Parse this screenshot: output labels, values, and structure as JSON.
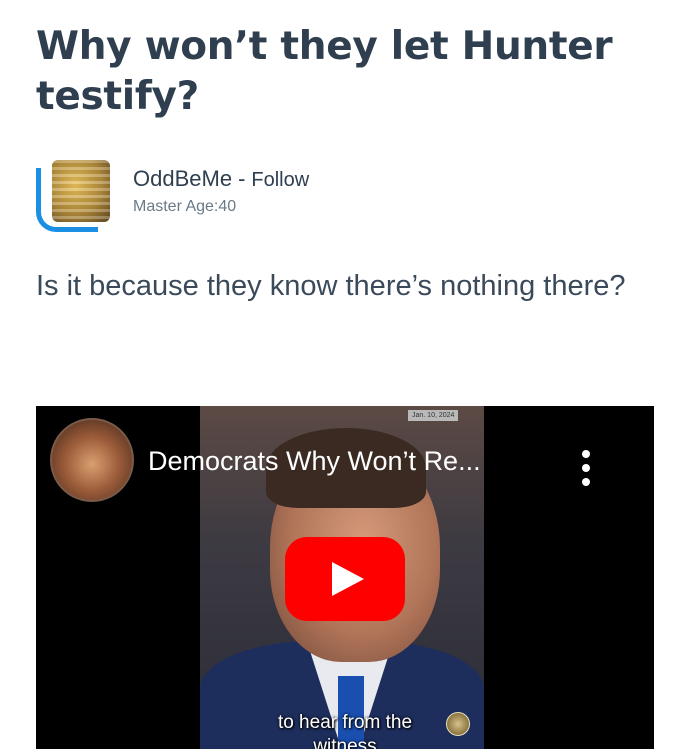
{
  "article": {
    "title": "Why won’t they let Hunter testify?",
    "body": "Is it because they know there’s nothing there?"
  },
  "author": {
    "name": "OddBeMe",
    "separator": "-",
    "follow_label": "Follow",
    "meta": "Master Age:40"
  },
  "video": {
    "title": "Democrats Why Won’t Re...",
    "date_tag": "Jan. 10, 2024",
    "caption_line1": "to hear from the",
    "caption_line2": "witness",
    "play_icon": "youtube-play-icon",
    "menu_icon": "more-vert-icon",
    "accent_color": "#ff0000"
  }
}
